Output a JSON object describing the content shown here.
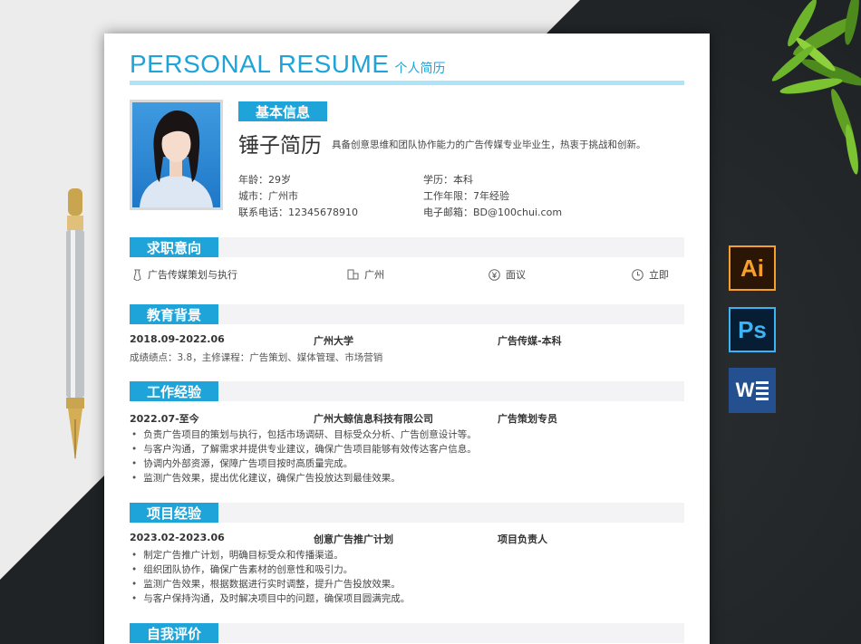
{
  "resume": {
    "title": "PERSONAL RESUME",
    "subtitle": "个人简历",
    "basic_info_label": "基本信息",
    "name": "锤子简历",
    "tagline": "具备创意思维和团队协作能力的广告传媒专业毕业生，热衷于挑战和创新。",
    "info": {
      "age": "年龄：29岁",
      "education": "学历：本科",
      "city": "城市：广州市",
      "work_years": "工作年限：7年经验",
      "phone": "联系电话：12345678910",
      "email": "电子邮箱：BD@100chui.com"
    },
    "sections": {
      "intent": "求职意向",
      "education": "教育背景",
      "work": "工作经验",
      "project": "项目经验",
      "self": "自我评价"
    },
    "intent": {
      "position": "广告传媒策划与执行",
      "city": "广州",
      "salary": "面议",
      "availability": "立即"
    },
    "education": {
      "period": "2018.09-2022.06",
      "school": "广州大学",
      "major": "广告传媒-本科",
      "detail": "成绩绩点：3.8，主修课程：广告策划、媒体管理、市场营销"
    },
    "work": {
      "period": "2022.07-至今",
      "company": "广州大鲸信息科技有限公司",
      "role": "广告策划专员",
      "bullets": [
        "负责广告项目的策划与执行，包括市场调研、目标受众分析、广告创意设计等。",
        "与客户沟通，了解需求并提供专业建议，确保广告项目能够有效传达客户信息。",
        "协调内外部资源，保障广告项目按时高质量完成。",
        "监测广告效果，提出优化建议，确保广告投放达到最佳效果。"
      ]
    },
    "project": {
      "period": "2023.02-2023.06",
      "name": "创意广告推广计划",
      "role": "项目负责人",
      "bullets": [
        "制定广告推广计划，明确目标受众和传播渠道。",
        "组织团队协作，确保广告素材的创意性和吸引力。",
        "监测广告效果，根据数据进行实时调整，提升广告投放效果。",
        "与客户保持沟通，及时解决项目中的问题，确保项目圆满完成。"
      ]
    }
  },
  "software_icons": {
    "illustrator": "Ai",
    "photoshop": "Ps",
    "word": "W"
  },
  "colors": {
    "accent": "#1ea4d9",
    "accent_light": "#aee4f7",
    "section_bg": "#f3f3f6",
    "dark_bg": "#1f2325"
  }
}
